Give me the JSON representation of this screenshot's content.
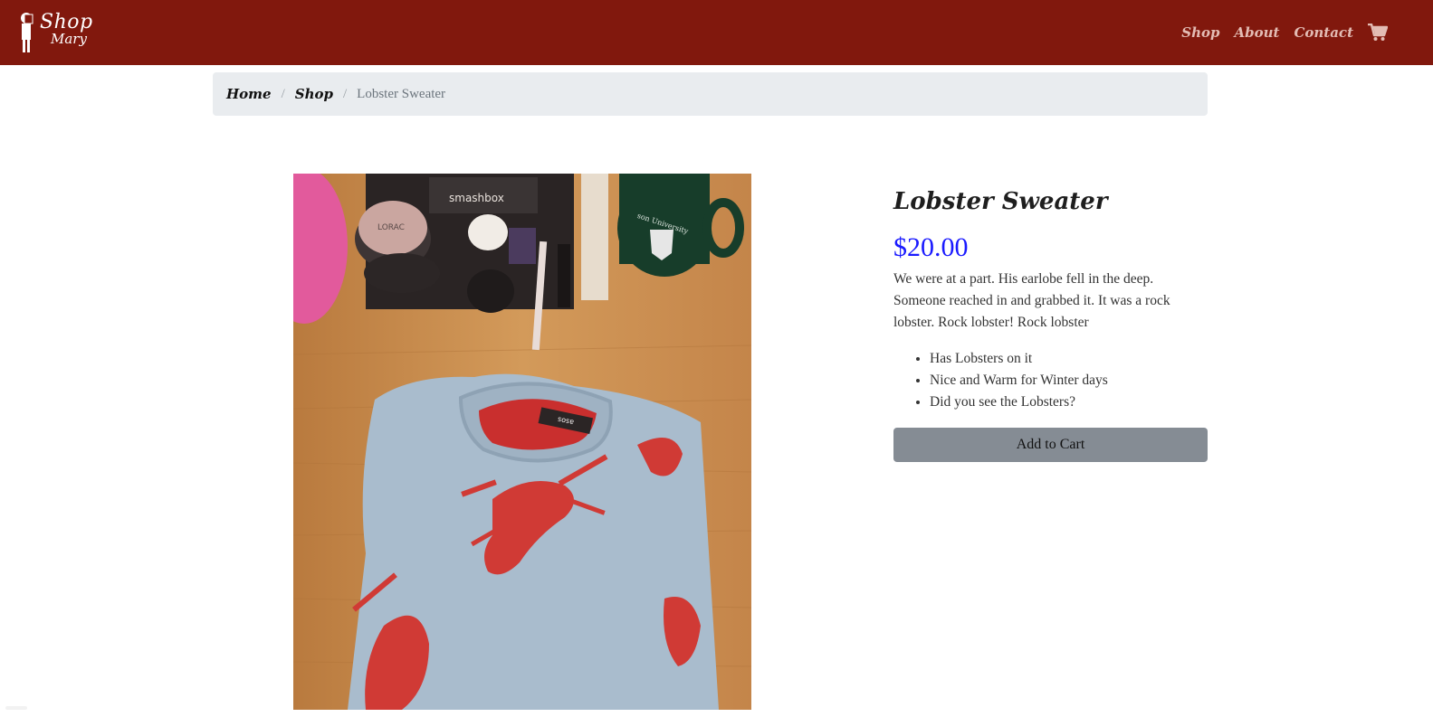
{
  "colors": {
    "navbar": "#81180d",
    "nav_link": "#e3bcb4",
    "price": "#1a1aff",
    "button": "#858c94",
    "breadcrumb_bg": "#e9ecef"
  },
  "brand": {
    "line1": "Shop",
    "line2": "Mary"
  },
  "nav": {
    "links": [
      {
        "label": "Shop"
      },
      {
        "label": "About"
      },
      {
        "label": "Contact"
      }
    ],
    "cart_icon": "shopping-cart-icon"
  },
  "breadcrumb": {
    "home": "Home",
    "shop": "Shop",
    "current": "Lobster Sweater"
  },
  "product": {
    "title": "Lobster Sweater",
    "price": "$20.00",
    "description": "We were at a part. His earlobe fell in the deep. Someone reached in and grabbed it. It was a rock lobster. Rock lobster! Rock lobster",
    "features": [
      "Has Lobsters on it",
      "Nice and Warm for Winter days",
      "Did you see the Lobsters?"
    ],
    "add_to_cart": "Add to Cart",
    "image_labels": {
      "palette_brand": "smashbox",
      "compact_brand": "LORAC",
      "mug_text": "son University",
      "sweater_tag": "asos"
    }
  }
}
